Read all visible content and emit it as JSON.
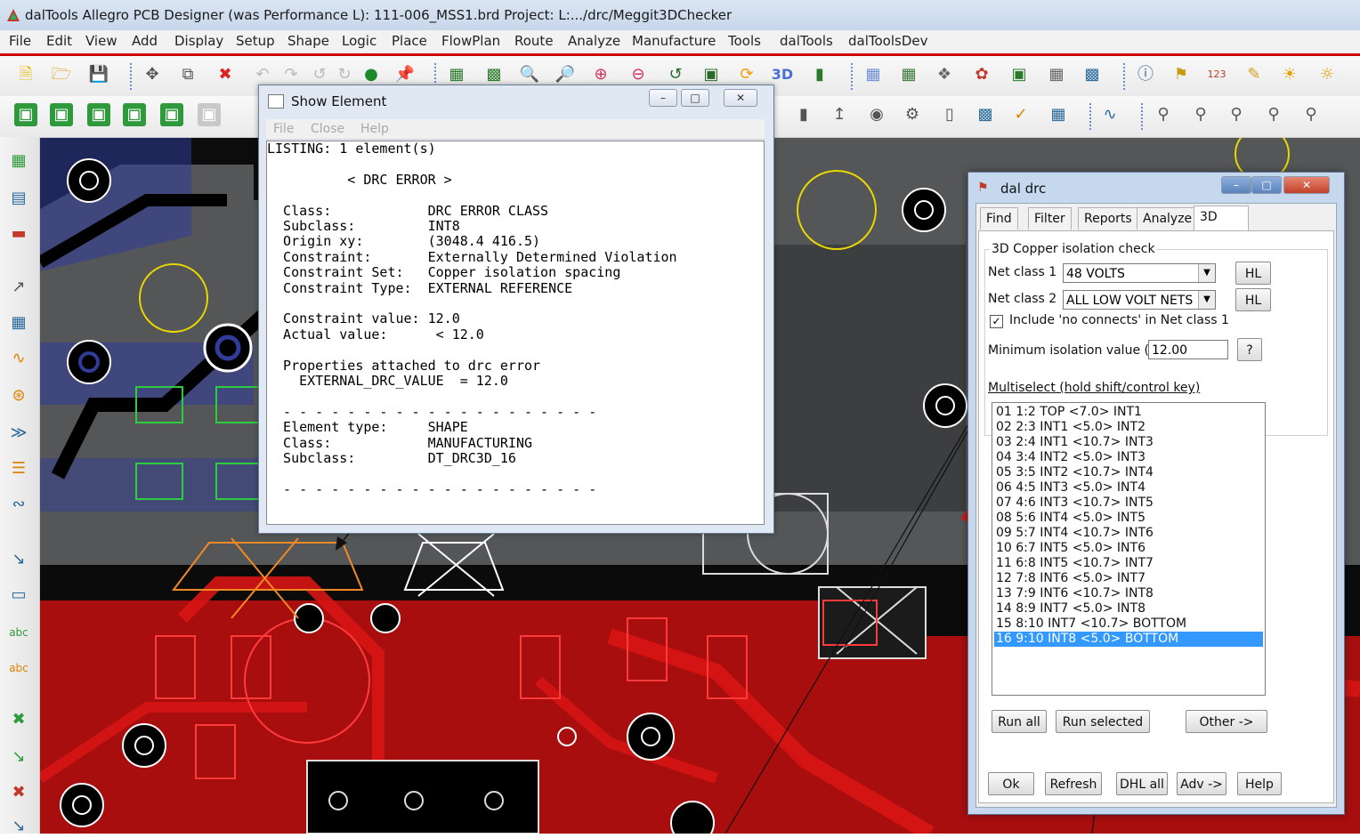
{
  "app": {
    "title": "dalTools Allegro PCB Designer (was Performance L): 111-006_MSS1.brd  Project: L:.../drc/Meggit3DChecker"
  },
  "menu": [
    "File",
    "Edit",
    "View",
    "Add",
    "Display",
    "Setup",
    "Shape",
    "Logic",
    "Place",
    "FlowPlan",
    "Route",
    "Analyze",
    "Manufacture",
    "Tools",
    "dalTools",
    "dalToolsDev"
  ],
  "show_element": {
    "title": "Show Element",
    "menu": [
      "File",
      "Close",
      "Help"
    ],
    "listing": [
      "LISTING: 1 element(s)",
      "",
      "          < DRC ERROR >",
      "",
      "  Class:            DRC ERROR CLASS",
      "  Subclass:         INT8",
      "  Origin xy:        (3048.4 416.5)",
      "  Constraint:       Externally Determined Violation",
      "  Constraint Set:   Copper isolation spacing",
      "  Constraint Type:  EXTERNAL REFERENCE",
      "",
      "  Constraint value: 12.0",
      "  Actual value:      < 12.0",
      "",
      "  Properties attached to drc error",
      "    EXTERNAL_DRC_VALUE  = 12.0",
      "",
      "  - - - - - - - - - - - - - - - - - - - -",
      "  Element type:     SHAPE",
      "  Class:            MANUFACTURING",
      "  Subclass:         DT_DRC3D_16",
      "",
      "  - - - - - - - - - - - - - - - - - - - -"
    ]
  },
  "dal_drc": {
    "title": "dal drc",
    "tabs": [
      "Find",
      "Filter",
      "Reports",
      "Analyze",
      "3D"
    ],
    "group_title": "3D Copper isolation check",
    "net_class_1_label": "Net class 1",
    "net_class_1_value": "48 VOLTS",
    "net_class_2_label": "Net class 2",
    "net_class_2_value": "ALL LOW VOLT NETS",
    "hl_label": "HL",
    "include_label": "Include 'no connects' in Net class 1",
    "include_checked": true,
    "min_iso_label": "Minimum isolation value (x)",
    "min_iso_value": "12.00",
    "help_q": "?",
    "multiselect_label": "Multiselect (hold shift/control key)",
    "list": [
      "01 1:2 TOP <7.0> INT1",
      "02 2:3 INT1 <5.0> INT2",
      "03 2:4 INT1 <10.7> INT3",
      "04 3:4 INT2 <5.0> INT3",
      "05 3:5 INT2 <10.7> INT4",
      "06 4:5 INT3 <5.0> INT4",
      "07 4:6 INT3 <10.7> INT5",
      "08 5:6 INT4 <5.0> INT5",
      "09 5:7 INT4 <10.7> INT6",
      "10 6:7 INT5 <5.0> INT6",
      "11 6:8 INT5 <10.7> INT7",
      "12 7:8 INT6 <5.0> INT7",
      "13 7:9 INT6 <10.7> INT8",
      "14 8:9 INT7 <5.0> INT8",
      "15 8:10 INT7 <10.7> BOTTOM",
      "16 9:10 INT8 <5.0> BOTTOM"
    ],
    "selected_index": 15,
    "buttons_mid": [
      "Run all",
      "Run selected",
      "Other ->"
    ],
    "buttons_bottom": [
      "Ok",
      "Refresh",
      "DHL all",
      "Adv ->",
      "Help"
    ]
  },
  "colors": {
    "menu_underline": "#cc0000",
    "board_red": "#a80e0e",
    "board_dark": "#545658",
    "selection": "#3399ff"
  }
}
